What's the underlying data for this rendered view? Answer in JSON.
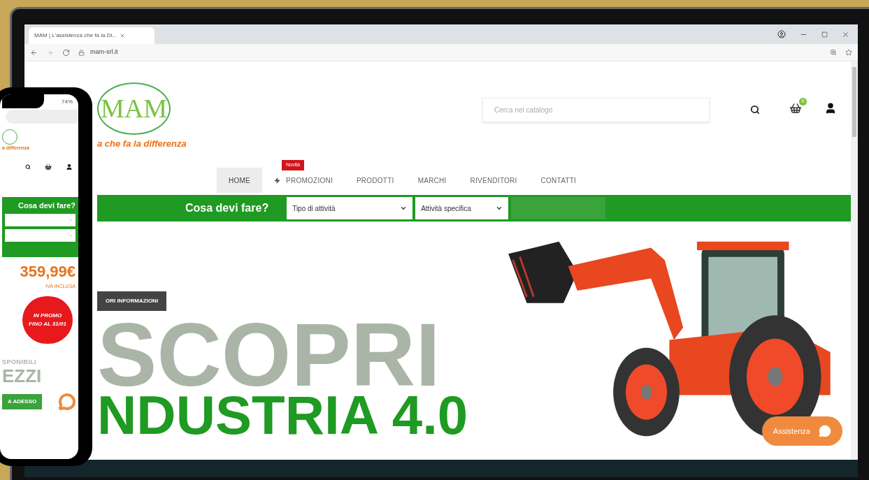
{
  "browser": {
    "tab_title": "MAM | L'assistenza che fa la Di...",
    "url": "mam-srl.it"
  },
  "header": {
    "logo": "MAM",
    "slogan": "a che fa la differenza",
    "search": {
      "placeholder": "Cerca nel catalogo"
    },
    "cart_count": "0"
  },
  "nav": [
    {
      "label": "HOME",
      "selected": true
    },
    {
      "label": "PROMOZIONI",
      "selected": false,
      "badge": "Novità"
    },
    {
      "label": "PRODOTTI",
      "selected": false
    },
    {
      "label": "MARCHI",
      "selected": false
    },
    {
      "label": "RIVENDITORI",
      "selected": false
    },
    {
      "label": "CONTATTI",
      "selected": false
    }
  ],
  "finder": {
    "title": "Cosa devi fare?",
    "selects": [
      "Tipo di attività",
      "Attività specifica"
    ]
  },
  "hero": {
    "button": "ORI INFORMAZIONI",
    "line_1": "SCOPRI",
    "line_2": "NDUSTRIA 4.0"
  },
  "chat": {
    "label": "Assistenza"
  },
  "phone": {
    "battery": "74%",
    "slogan": "a differenza",
    "finder_title": "Cosa devi fare?",
    "price": "359,99€",
    "price_note": "IVA INCLUSA",
    "promo": "IN PROMO FINO AL 31/01",
    "line_1": "SPONIBILI",
    "line_2": "EZZI",
    "button": "A ADESSO"
  }
}
